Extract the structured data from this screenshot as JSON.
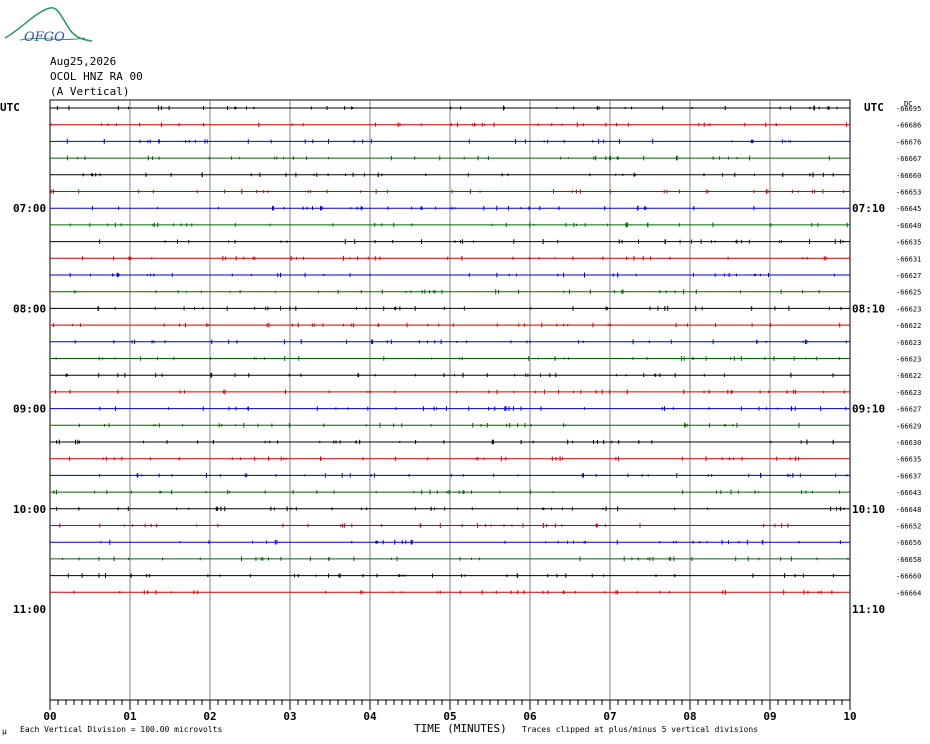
{
  "header": {
    "logo_text": "OFGO",
    "date": "Aug25,2026",
    "station": "OCOL HNZ RA 00",
    "component": "(A Vertical)"
  },
  "left_axis_title": "UTC",
  "right_axis_title": "UTC",
  "dc_title": "DC",
  "footer": {
    "left_mark": "µ",
    "scale_note": "Each Vertical Division =  100.00 microvolts",
    "xlabel": "TIME (MINUTES)",
    "clip_note": "Traces clipped at plus/minus 5 vertical divisions"
  },
  "colors": {
    "black": "#000000",
    "red": "#cc0000",
    "blue": "#0000cc",
    "green": "#006600",
    "grid": "#808080"
  },
  "chart_data": {
    "type": "line",
    "title": "",
    "xlabel": "TIME (MINUTES)",
    "xlim": [
      0,
      10
    ],
    "x_ticks": [
      "00",
      "01",
      "02",
      "03",
      "04",
      "05",
      "06",
      "07",
      "08",
      "09",
      "10"
    ],
    "left_time_labels": [
      "07:00",
      "08:00",
      "09:00",
      "10:00",
      "11:00"
    ],
    "right_time_labels": [
      "07:10",
      "08:10",
      "09:10",
      "10:10",
      "11:10"
    ],
    "trace_colors": [
      "black",
      "red",
      "blue",
      "green"
    ],
    "traces_dc": [
      "-66695",
      "-66686",
      "-66676",
      "-66667",
      "-66660",
      "-66653",
      "-66645",
      "-66640",
      "-66635",
      "-66631",
      "-66627",
      "-66625",
      "-66623",
      "-66622",
      "-66623",
      "-66623",
      "-66622",
      "-66623",
      "-66627",
      "-66629",
      "-66630",
      "-66635",
      "-66637",
      "-66643",
      "-66648",
      "-66652",
      "-66656",
      "-66658",
      "-66660",
      "-66664"
    ]
  }
}
